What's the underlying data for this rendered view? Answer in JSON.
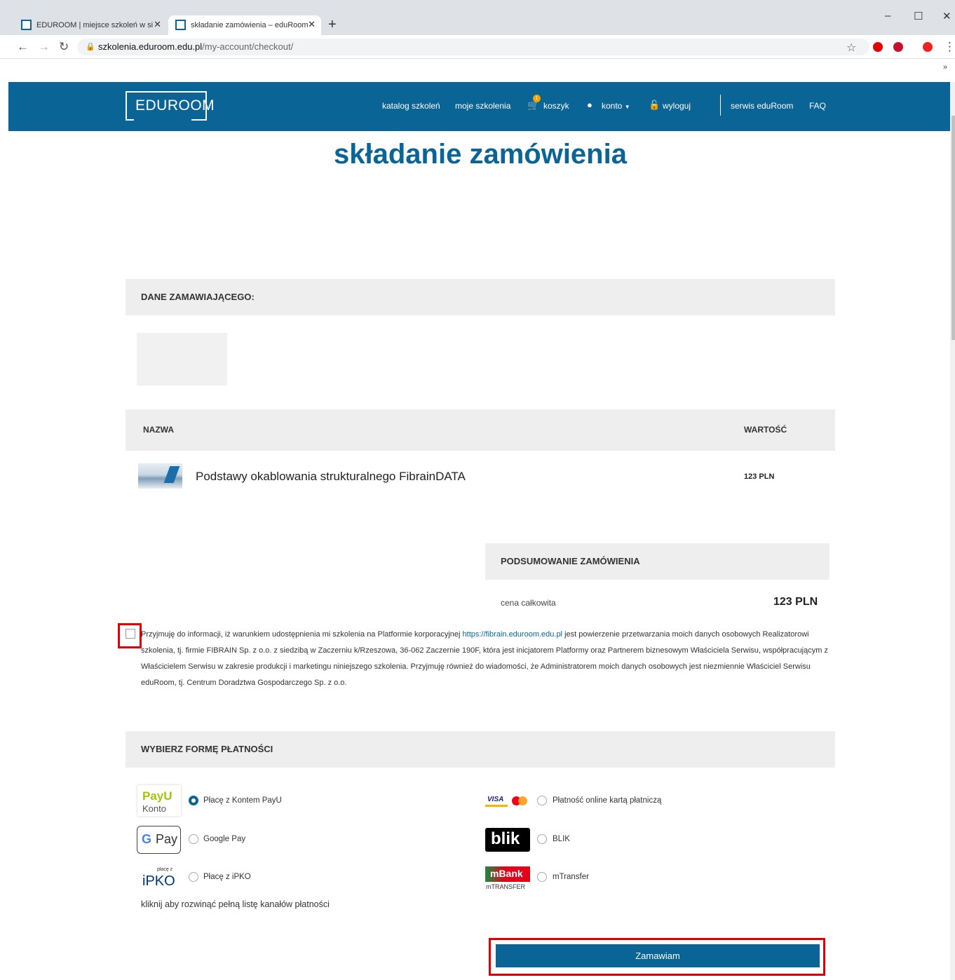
{
  "browser": {
    "tabs": [
      {
        "title": "EDUROOM | miejsce szkoleń w si",
        "close": "✕"
      },
      {
        "title": "składanie zamówienia – eduRoom",
        "close": "✕"
      }
    ],
    "new_tab": "+",
    "window_controls": {
      "minimize": "–",
      "maximize": "☐",
      "close": "✕"
    },
    "url_domain": "szkolenia.eduroom.edu.pl",
    "url_path": "/my-account/checkout/",
    "more_bookmarks": "»"
  },
  "header": {
    "logo": "EDUROOM",
    "nav": {
      "catalog": "katalog szkoleń",
      "my_trainings": "moje szkolenia",
      "cart": "koszyk",
      "cart_count": "1",
      "account": "konto",
      "logout": "wyloguj",
      "service": "serwis eduRoom",
      "faq": "FAQ"
    }
  },
  "page": {
    "title": "składanie zamówienia"
  },
  "orderer": {
    "heading": "DANE ZAMAWIAJĄCEGO:"
  },
  "items": {
    "col_name": "NAZWA",
    "col_value": "WARTOŚĆ",
    "rows": [
      {
        "name": "Podstawy okablowania strukturalnego FibrainDATA",
        "price": "123 PLN"
      }
    ]
  },
  "summary": {
    "heading": "PODSUMOWANIE ZAMÓWIENIA",
    "total_label": "cena całkowita",
    "total_value": "123 PLN"
  },
  "consent": {
    "text_before": "Przyjmuję do informacji, iż warunkiem udostępnienia mi szkolenia na Platformie korporacyjnej ",
    "link": "https://fibrain.eduroom.edu.pl",
    "text_after": " jest powierzenie przetwarzania moich danych osobowych Realizatorowi szkolenia, tj. firmie FIBRAIN Sp. z o.o. z siedzibą w Zaczerniu k/Rzeszowa, 36-062 Zaczernie 190F, która jest inicjatorem Platformy oraz Partnerem biznesowym Właściciela Serwisu, współpracującym z Właścicielem Serwisu w zakresie produkcji i marketingu niniejszego szkolenia. Przyjmuję również do wiadomości, że Administratorem moich danych osobowych jest niezmiennie Właściciel Serwisu eduRoom, tj. Centrum Doradztwa Gospodarczego Sp. z o.o.",
    "checked": false
  },
  "payment": {
    "heading": "WYBIERZ FORMĘ PŁATNOŚCI",
    "methods": [
      {
        "label": "Płacę z Kontem PayU",
        "selected": true
      },
      {
        "label": "Google Pay",
        "selected": false
      },
      {
        "label": "Płacę z iPKO",
        "selected": false
      },
      {
        "label": "Płatność online kartą płatniczą",
        "selected": false
      },
      {
        "label": "BLIK",
        "selected": false
      },
      {
        "label": "mTransfer",
        "selected": false
      }
    ],
    "logos": {
      "payu_top": "PayU",
      "payu_bottom": "Konto",
      "gpay_g": "G",
      "gpay_text": "Pay",
      "ipko_small": "płacę z",
      "ipko_text": "iPKO",
      "visa": "VISA",
      "blik": "blik",
      "mbank": "mBank",
      "mtransfer": "mTRANSFER"
    },
    "expand_link": "kliknij aby rozwinąć pełną listę kanałów płatności"
  },
  "order_button": "Zamawiam",
  "colors": {
    "brand": "#0a6496",
    "highlight": "#e00000",
    "bar_bg": "#eeeeee"
  }
}
